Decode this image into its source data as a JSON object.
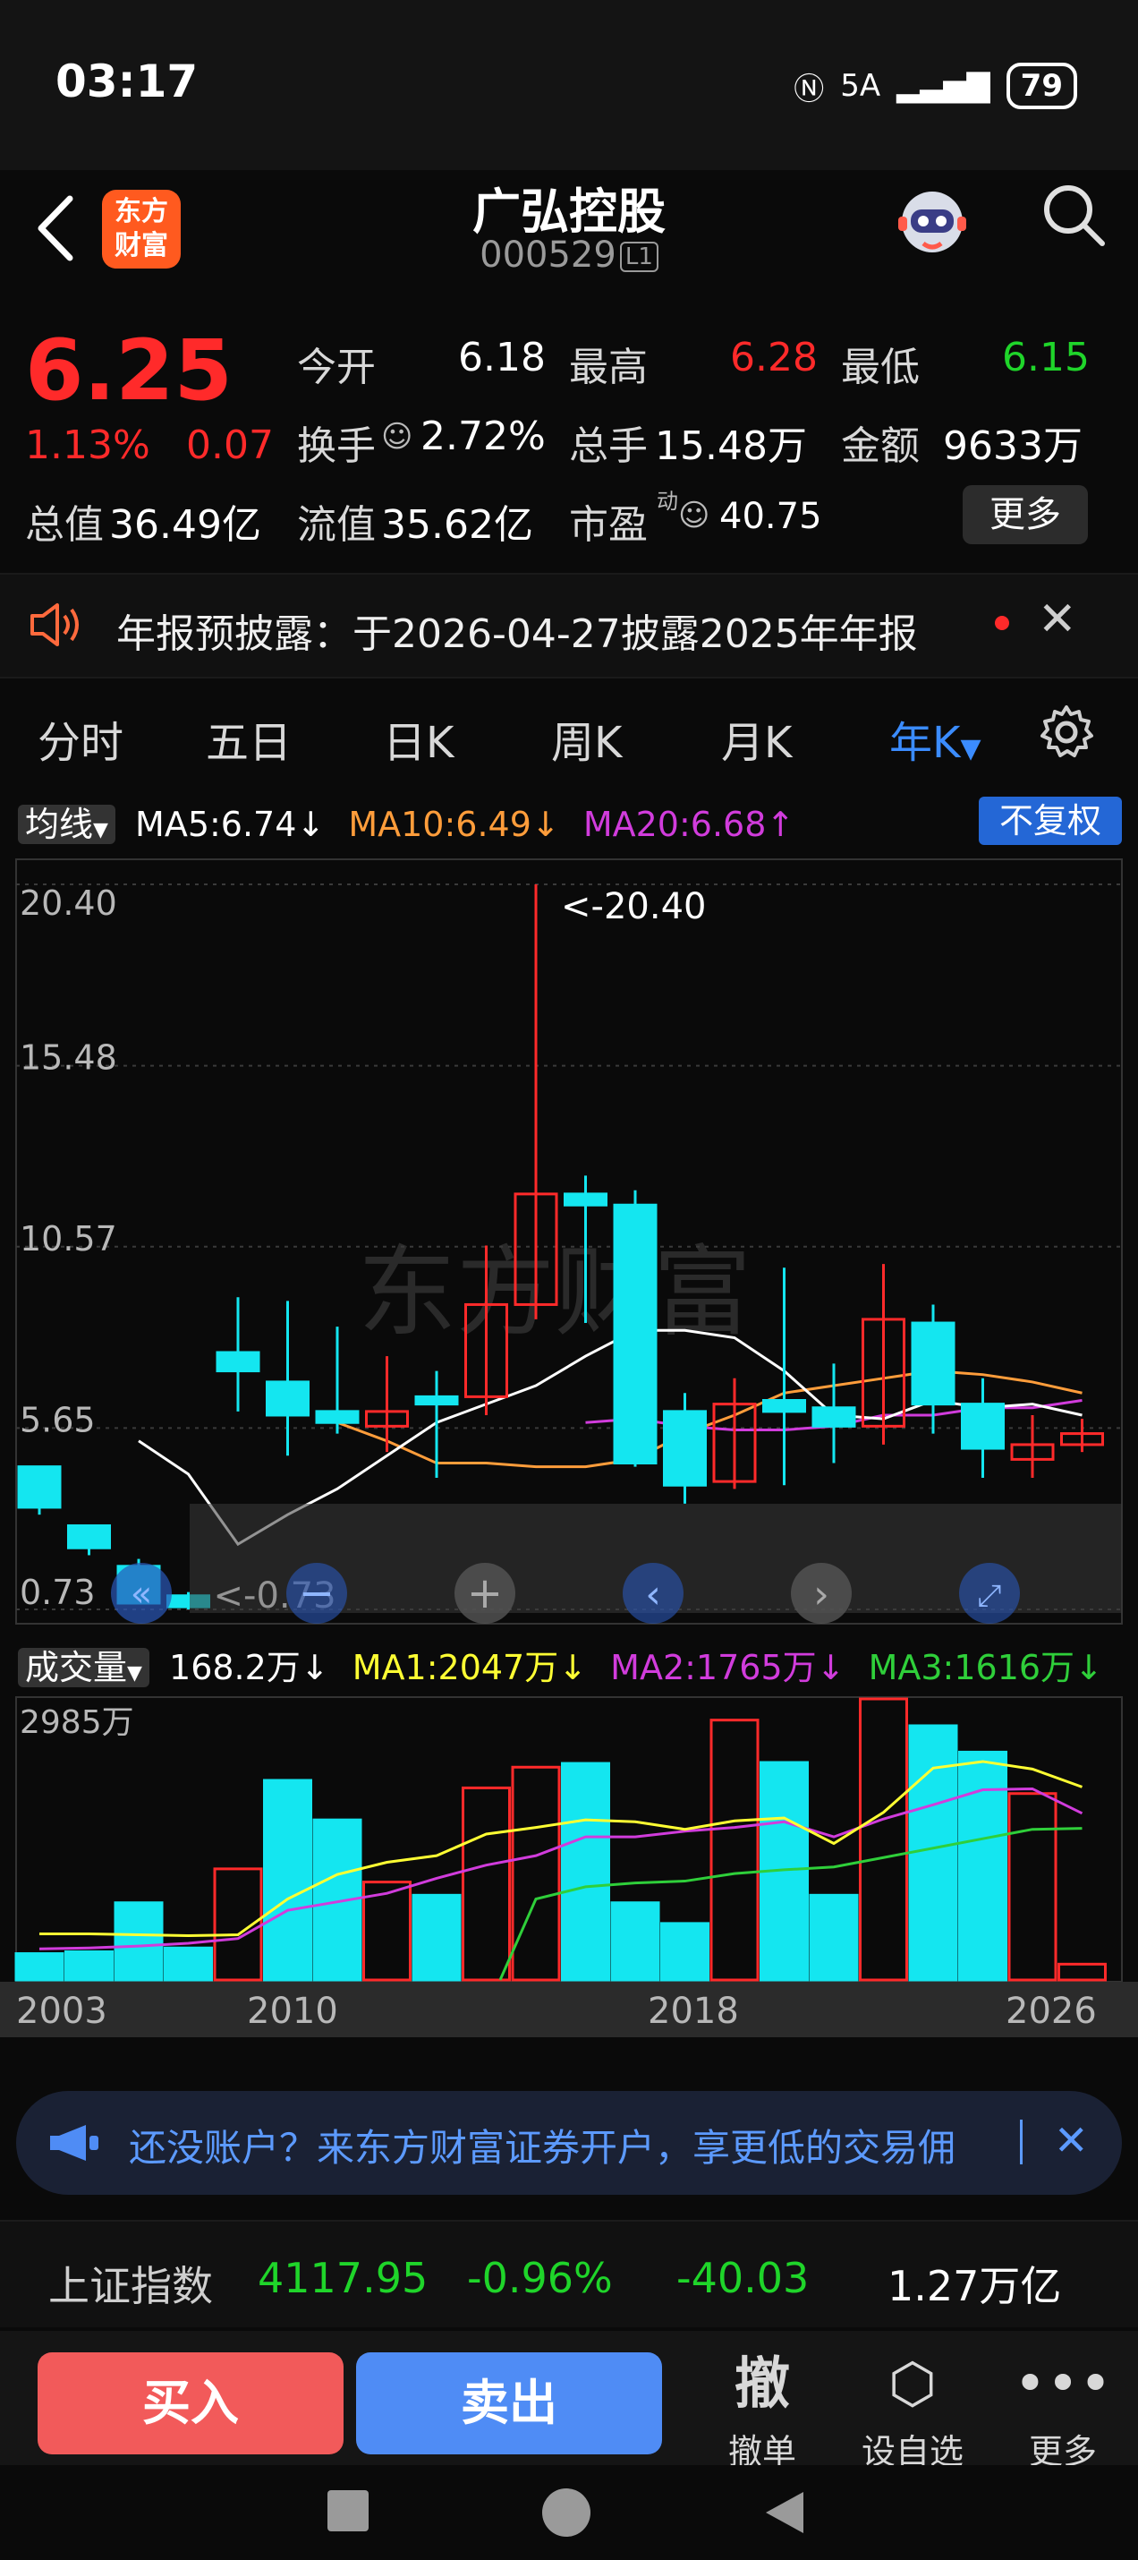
{
  "status": {
    "time": "03:17",
    "network": "5A",
    "battery": "79"
  },
  "header": {
    "name": "广弘控股",
    "code": "000529",
    "level": "L1",
    "logo": "东方\n财富"
  },
  "quote": {
    "price": "6.25",
    "change_pct": "1.13%",
    "change": "0.07",
    "open_label": "今开",
    "open": "6.18",
    "high_label": "最高",
    "high": "6.28",
    "low_label": "最低",
    "low": "6.15",
    "turnover_label": "换手",
    "turnover": "2.72%",
    "volume_label": "总手",
    "volume": "15.48万",
    "amount_label": "金额",
    "amount": "9633万",
    "mcap_label": "总值",
    "mcap": "36.49亿",
    "float_label": "流值",
    "float_mcap": "35.62亿",
    "pe_label": "市盈",
    "pe_sup": "动",
    "pe": "40.75",
    "more": "更多"
  },
  "notice": {
    "text": "年报预披露：于2026-04-27披露2025年年报"
  },
  "tabs": [
    "分时",
    "五日",
    "日K",
    "周K",
    "月K",
    "年K"
  ],
  "ma_legend": {
    "label": "均线",
    "ma5": "MA5:6.74↓",
    "ma10": "MA10:6.49↓",
    "ma20": "MA20:6.68↑",
    "adjust": "不复权"
  },
  "vol_legend": {
    "label": "成交量",
    "vol": "168.2万↓",
    "ma1": "MA1:2047万↓",
    "ma2": "MA2:1765万↓",
    "ma3": "MA3:1616万↓"
  },
  "chart_data": [
    {
      "type": "candlestick",
      "y_ticks": [
        "20.40",
        "15.48",
        "10.57",
        "5.65",
        "0.73"
      ],
      "ylim": [
        0.73,
        20.4
      ],
      "annotations": [
        "<-20.40",
        "<-0.73"
      ],
      "watermark": "东方财富",
      "colors": {
        "up": "#ff2a2a",
        "down": "#14e6f0",
        "ma5": "#ffffff",
        "ma10": "#ff9d3b",
        "ma20": "#d13cdc"
      },
      "candles": [
        {
          "o": 4.6,
          "c": 3.5,
          "h": 4.6,
          "l": 3.3
        },
        {
          "o": 3.0,
          "c": 2.4,
          "h": 3.0,
          "l": 2.2
        },
        {
          "o": 1.9,
          "c": 0.9,
          "h": 2.1,
          "l": 0.9
        },
        {
          "o": 1.1,
          "c": 0.8,
          "h": 1.2,
          "l": 0.73
        },
        {
          "o": 7.7,
          "c": 7.2,
          "h": 9.2,
          "l": 6.1
        },
        {
          "o": 6.9,
          "c": 6.0,
          "h": 9.1,
          "l": 4.9
        },
        {
          "o": 6.1,
          "c": 5.8,
          "h": 8.4,
          "l": 5.5
        },
        {
          "o": 5.7,
          "c": 6.1,
          "h": 7.6,
          "l": 5.0
        },
        {
          "o": 6.5,
          "c": 6.3,
          "h": 7.2,
          "l": 4.3
        },
        {
          "o": 6.5,
          "c": 9.0,
          "h": 10.6,
          "l": 6.0
        },
        {
          "o": 9.0,
          "c": 12.0,
          "h": 20.4,
          "l": 8.6
        },
        {
          "o": 12.0,
          "c": 11.7,
          "h": 12.5,
          "l": 8.5
        },
        {
          "o": 11.7,
          "c": 4.7,
          "h": 12.1,
          "l": 4.6
        },
        {
          "o": 6.1,
          "c": 4.1,
          "h": 6.6,
          "l": 3.6
        },
        {
          "o": 4.2,
          "c": 6.3,
          "h": 7.0,
          "l": 4.0
        },
        {
          "o": 6.4,
          "c": 6.1,
          "h": 10.0,
          "l": 4.1
        },
        {
          "o": 6.2,
          "c": 5.7,
          "h": 7.4,
          "l": 4.7
        },
        {
          "o": 5.7,
          "c": 8.6,
          "h": 10.1,
          "l": 5.2
        },
        {
          "o": 8.5,
          "c": 6.3,
          "h": 9.0,
          "l": 5.5
        },
        {
          "o": 6.3,
          "c": 5.1,
          "h": 7.0,
          "l": 4.3
        },
        {
          "o": 4.8,
          "c": 5.2,
          "h": 6.0,
          "l": 4.3
        },
        {
          "o": 5.2,
          "c": 5.5,
          "h": 5.9,
          "l": 5.0
        }
      ],
      "ma5": [
        5.3,
        4.4,
        2.5,
        3.3,
        4.0,
        4.9,
        5.8,
        6.3,
        6.8,
        7.6,
        8.3,
        8.3,
        8.1,
        7.2,
        6.0,
        5.9,
        6.4,
        6.2,
        6.3,
        6.0
      ],
      "ma10": [
        5.8,
        5.3,
        4.7,
        4.7,
        4.6,
        4.6,
        4.8,
        5.5,
        6.0,
        6.6,
        6.8,
        7.0,
        7.2,
        7.1,
        6.9,
        6.6
      ],
      "ma20": [
        5.8,
        5.9,
        5.7,
        5.6,
        5.6,
        5.7,
        6.0,
        6.0,
        6.2,
        6.2,
        6.4
      ]
    },
    {
      "type": "bar",
      "title": "",
      "y_tick": "2985万",
      "x_ticks": [
        "2003",
        "2010",
        "2018",
        "2026"
      ],
      "colors": {
        "up": "#ff2a2a",
        "down": "#14e6f0",
        "ma1": "#ffff33",
        "ma2": "#d13cdc",
        "ma3": "#2fcf3a"
      },
      "bars": [
        {
          "v": 280,
          "up": false
        },
        {
          "v": 300,
          "up": false
        },
        {
          "v": 820,
          "up": false
        },
        {
          "v": 340,
          "up": false
        },
        {
          "v": 1180,
          "up": true
        },
        {
          "v": 2120,
          "up": false
        },
        {
          "v": 1700,
          "up": false
        },
        {
          "v": 1040,
          "up": true
        },
        {
          "v": 900,
          "up": false
        },
        {
          "v": 2040,
          "up": true
        },
        {
          "v": 2260,
          "up": true
        },
        {
          "v": 2300,
          "up": false
        },
        {
          "v": 820,
          "up": false
        },
        {
          "v": 600,
          "up": false
        },
        {
          "v": 2760,
          "up": true
        },
        {
          "v": 2310,
          "up": false
        },
        {
          "v": 900,
          "up": false
        },
        {
          "v": 2985,
          "up": true
        },
        {
          "v": 2700,
          "up": false
        },
        {
          "v": 2420,
          "up": false
        },
        {
          "v": 1980,
          "up": true
        },
        {
          "v": 168,
          "up": true
        }
      ],
      "ma1": [
        490,
        490,
        480,
        470,
        480,
        860,
        1120,
        1250,
        1320,
        1550,
        1620,
        1700,
        1680,
        1600,
        1690,
        1720,
        1450,
        1780,
        2250,
        2320,
        2240,
        2050
      ],
      "ma2": [
        330,
        340,
        360,
        390,
        440,
        740,
        830,
        920,
        1080,
        1220,
        1320,
        1520,
        1520,
        1580,
        1620,
        1680,
        1520,
        1710,
        1860,
        2020,
        2030,
        1770
      ],
      "ma3": [
        0,
        0,
        0,
        0,
        0,
        0,
        0,
        0,
        0,
        0,
        860,
        990,
        1030,
        1050,
        1130,
        1170,
        1200,
        1300,
        1400,
        1500,
        1600,
        1610
      ]
    }
  ],
  "promo": {
    "text": "还没账户？来东方财富证券开户，享更低的交易佣"
  },
  "index": {
    "name": "上证指数",
    "value": "4117.95",
    "pct": "-0.96%",
    "change": "-40.03",
    "amount": "1.27万亿"
  },
  "actions": {
    "buy": "买入",
    "sell": "卖出",
    "cancel_icon": "撤",
    "cancel": "撤单",
    "watch": "设自选",
    "more": "更多"
  }
}
